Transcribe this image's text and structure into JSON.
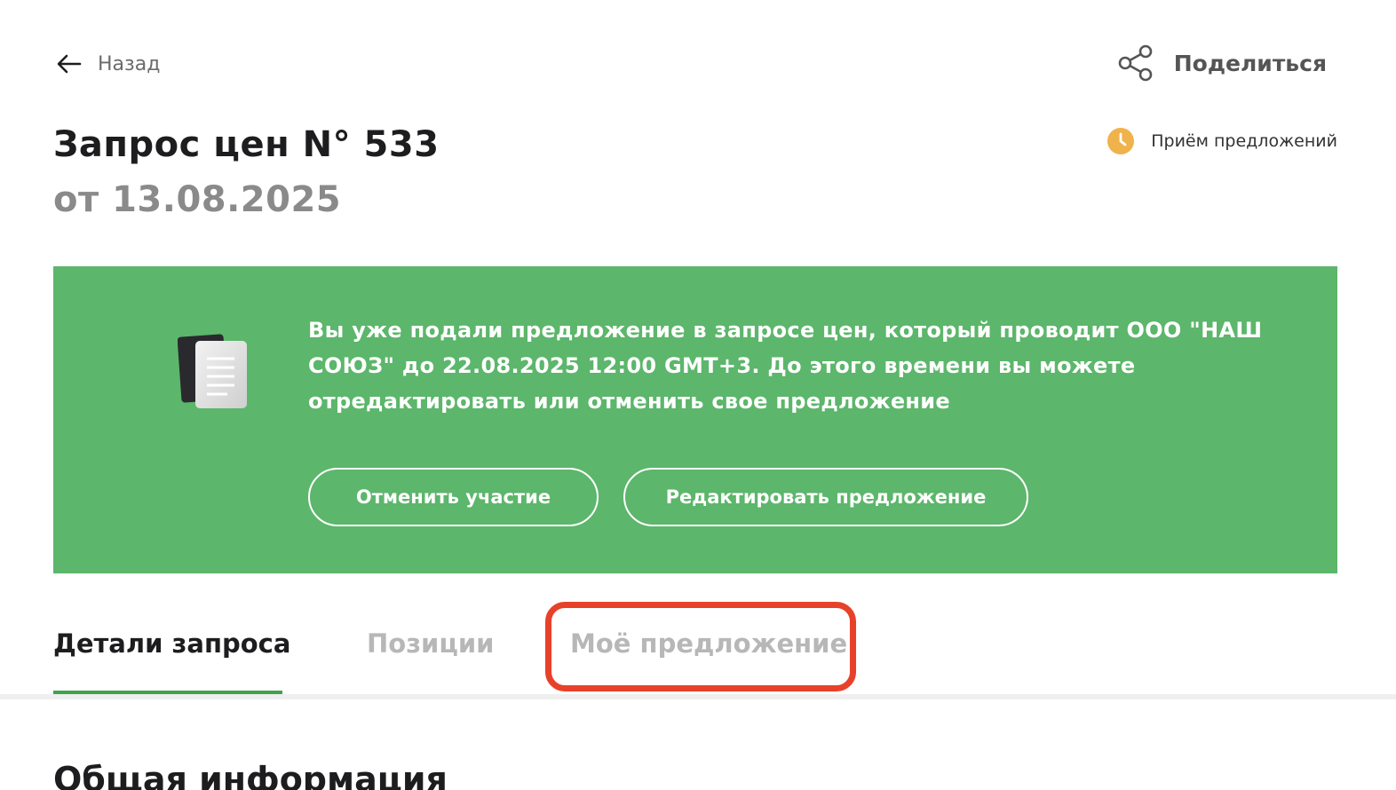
{
  "header": {
    "back_label": "Назад",
    "share_label": "Поделиться"
  },
  "request": {
    "title": "Запрос цен N° 533",
    "date": "от 13.08.2025",
    "status_label": "Приём предложений",
    "status_color": "#f0b24a"
  },
  "banner": {
    "background": "#5cb66b",
    "message": "Вы уже подали предложение в запросе цен, который проводит ООО \"НАШ СОЮЗ\" до 22.08.2025 12:00 GMT+3. До этого времени вы можете отредактировать или отменить свое предложение",
    "cancel_label": "Отменить участие",
    "edit_label": "Редактировать предложение",
    "icon": "documents-icon"
  },
  "tabs": [
    {
      "label": "Детали запроса",
      "active": true
    },
    {
      "label": "Позиции",
      "active": false
    },
    {
      "label": "Моё предложение",
      "active": false,
      "highlighted": true
    }
  ],
  "section": {
    "title": "Общая информация"
  },
  "colors": {
    "accent": "#3fa34d",
    "highlight": "#e8412a"
  }
}
